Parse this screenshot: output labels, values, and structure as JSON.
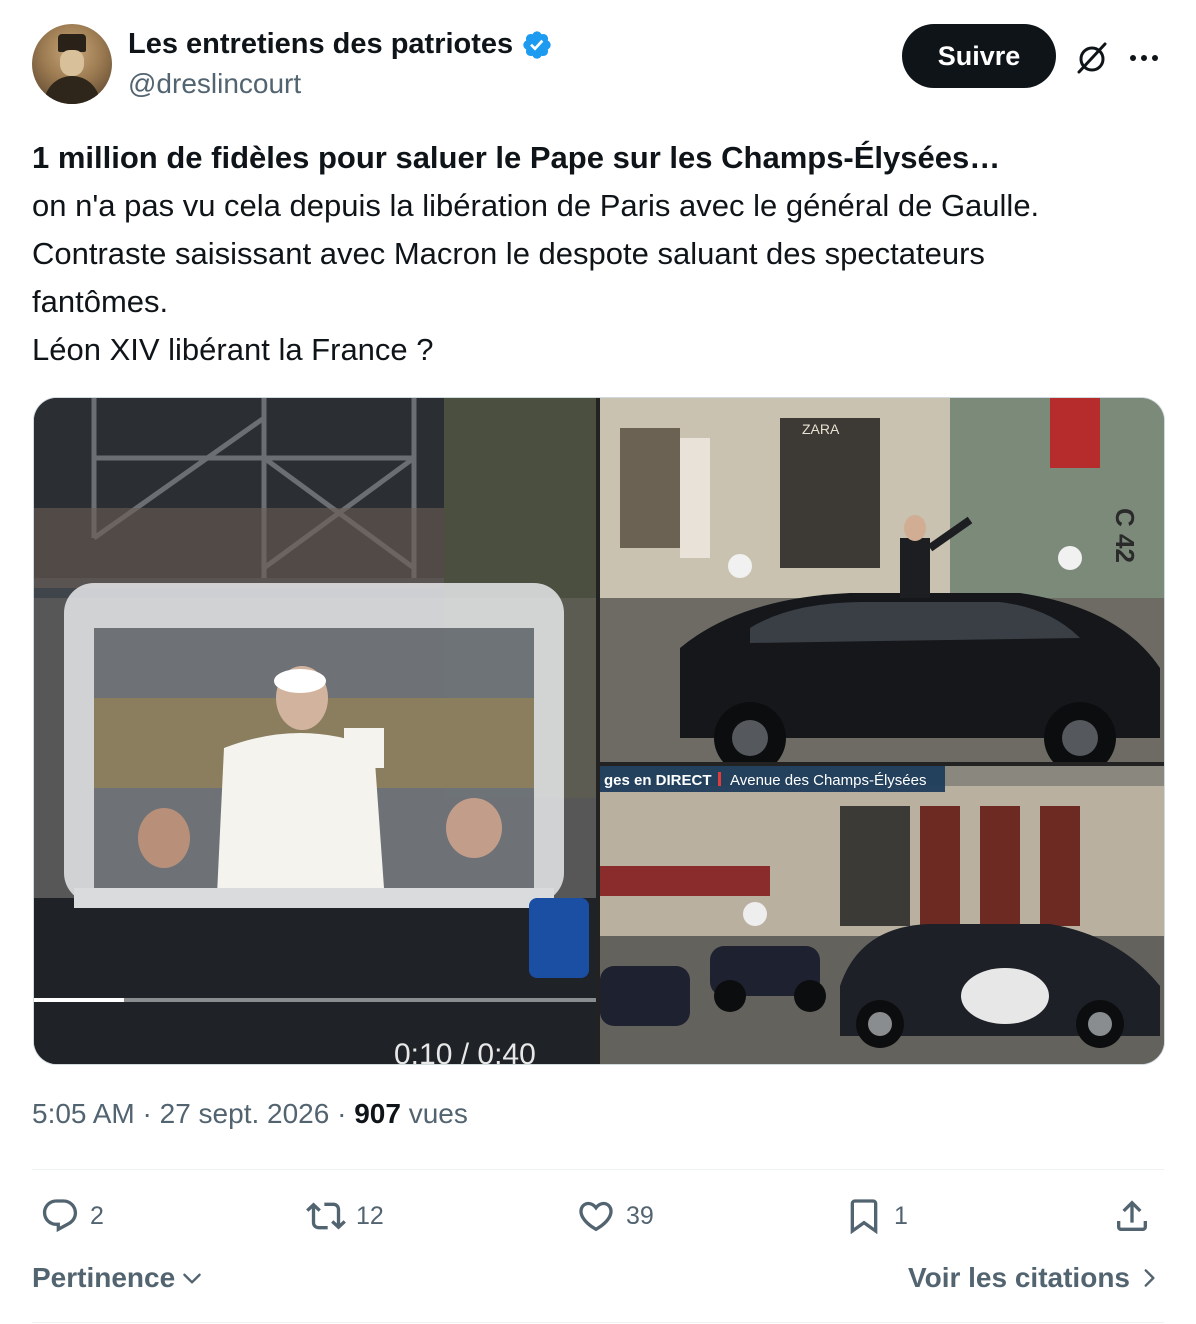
{
  "author": {
    "display_name": "Les entretiens des patriotes",
    "handle": "@dreslincourt",
    "verified": true
  },
  "follow_label": "Suivre",
  "tweet": {
    "lines": [
      "1 million de fidèles pour saluer le Pape sur les Champs-Élysées…",
      "on n'a pas vu cela depuis la libération de Paris avec le général de Gaulle.",
      "Contraste saisissant avec Macron le despote saluant des spectateurs",
      "fantômes.",
      "Léon XIV libérant la France ?"
    ]
  },
  "media": {
    "video_time": "0:10 / 0:40",
    "tv_banner": "ges en DIRECT",
    "tv_location": "Avenue des Champs-Élysées",
    "shop_sign": "ZARA",
    "building_number": "C 42"
  },
  "meta": {
    "time": "5:05 AM",
    "date": "27 sept. 2026",
    "separator": "·",
    "views_count": "907",
    "views_label": "vues"
  },
  "stats": {
    "replies": "2",
    "reposts": "12",
    "likes": "39",
    "bookmarks": "1"
  },
  "footer": {
    "sort_label": "Pertinence",
    "quotes_label": "Voir les citations"
  },
  "colors": {
    "verified": "#1d9bf0",
    "text_primary": "#0f1419",
    "text_secondary": "#536471",
    "follow_bg": "#0f1419"
  },
  "icons": [
    "verified-badge-icon",
    "grok-icon",
    "more-icon",
    "reply-icon",
    "repost-icon",
    "like-icon",
    "bookmark-icon",
    "share-icon",
    "chevron-down-icon",
    "chevron-right-icon"
  ]
}
